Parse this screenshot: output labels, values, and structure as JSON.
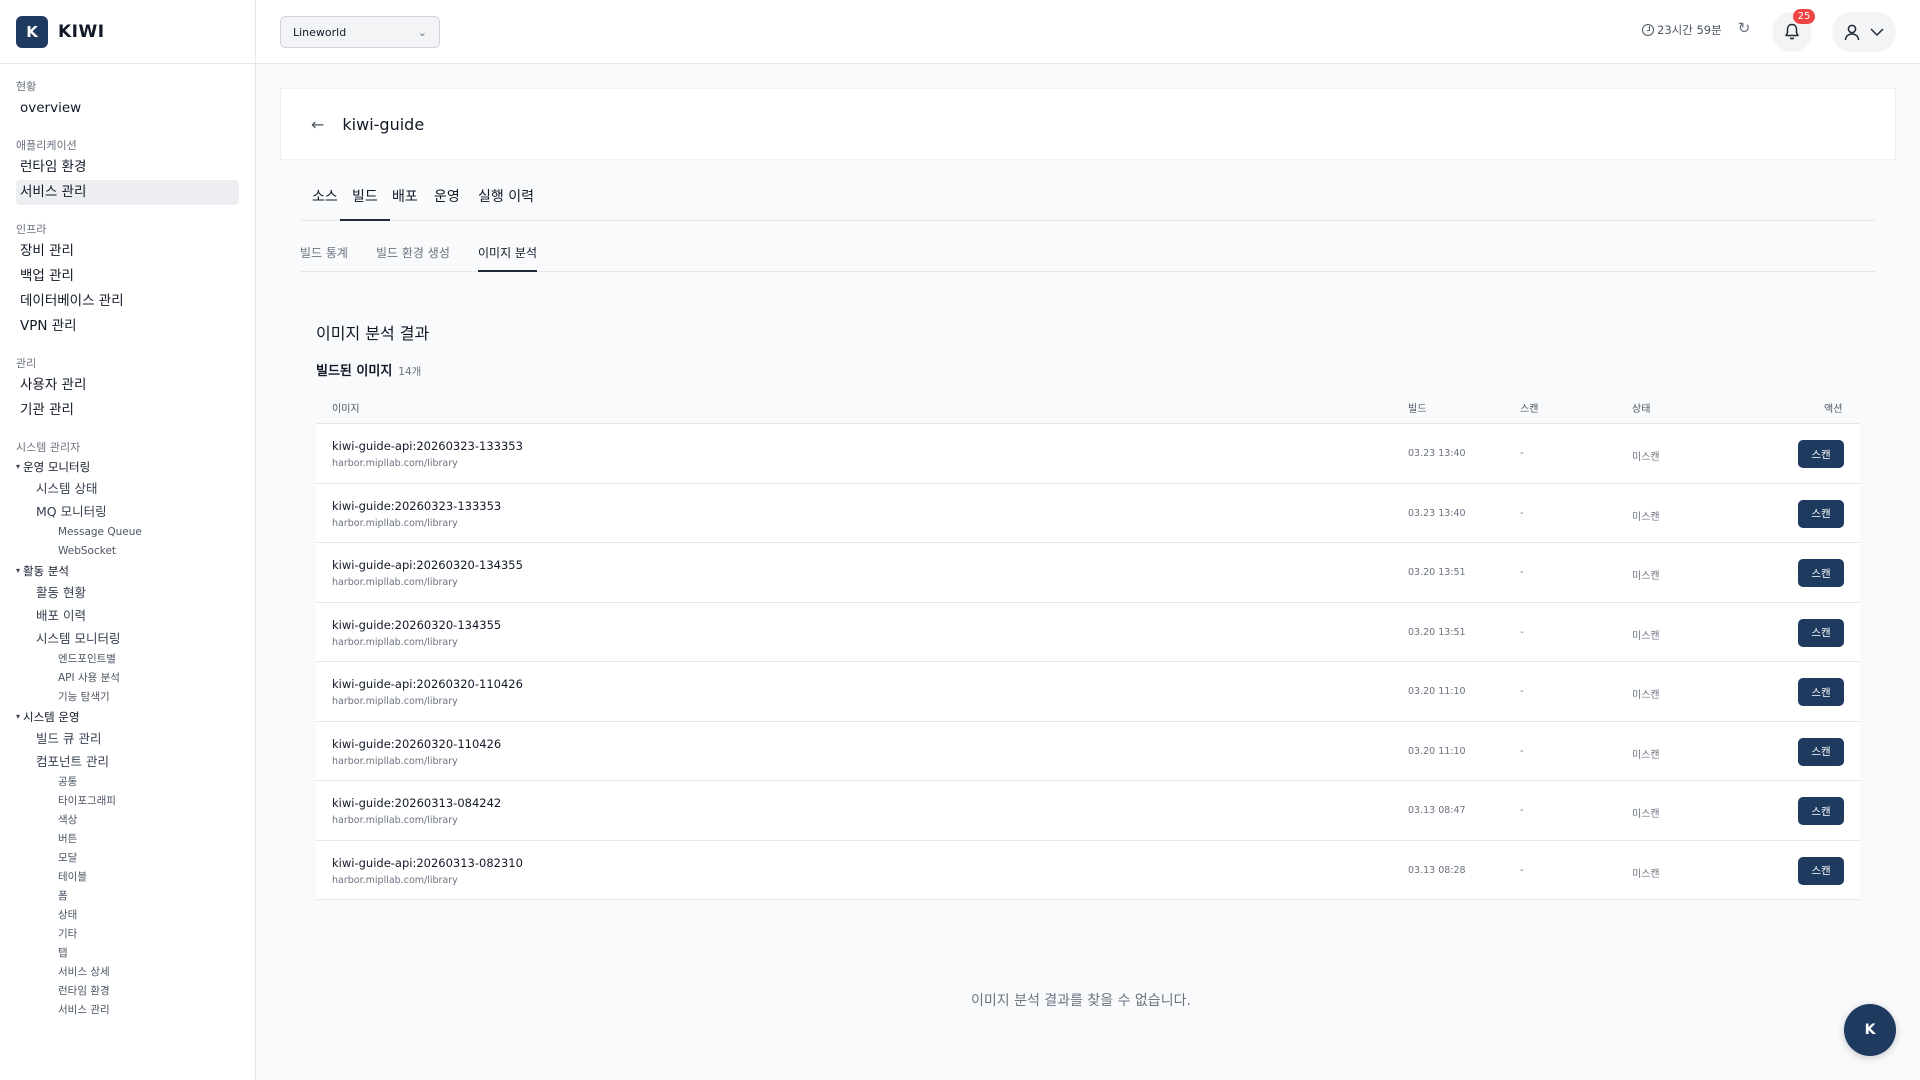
{
  "brand": {
    "logo": "K",
    "name": "KIWI"
  },
  "sidebar": {
    "sections": [
      {
        "label": "현황",
        "items": [
          {
            "label": "overview"
          }
        ]
      },
      {
        "label": "애플리케이션",
        "items": [
          {
            "label": "런타임 환경"
          },
          {
            "label": "서비스 관리",
            "active": true
          }
        ]
      },
      {
        "label": "인프라",
        "items": [
          {
            "label": "장비 관리"
          },
          {
            "label": "백업 관리"
          },
          {
            "label": "데이터베이스 관리"
          },
          {
            "label": "VPN 관리"
          }
        ]
      },
      {
        "label": "관리",
        "items": [
          {
            "label": "사용자 관리"
          },
          {
            "label": "기관 관리"
          }
        ]
      }
    ],
    "admin": {
      "label": "시스템 관리자",
      "groups": [
        {
          "label": "운영 모니터링",
          "children": [
            {
              "label": "시스템 상태"
            },
            {
              "label": "MQ 모니터링",
              "children": [
                "Message Queue",
                "WebSocket"
              ]
            }
          ]
        },
        {
          "label": "활동 분석",
          "children": [
            {
              "label": "활동 현황"
            },
            {
              "label": "배포 이력"
            },
            {
              "label": "시스템 모니터링",
              "children": [
                "엔드포인트별",
                "API 사용 분석",
                "기능 탐색기"
              ]
            }
          ]
        },
        {
          "label": "시스템 운영",
          "children": [
            {
              "label": "빌드 큐 관리"
            },
            {
              "label": "컴포넌트 관리",
              "children": [
                "공통",
                "타이포그래피",
                "색상",
                "버튼",
                "모달",
                "테이블",
                "폼",
                "상태",
                "기타",
                "탭",
                "서비스 상세",
                "런타임 환경",
                "서비스 관리"
              ]
            }
          ]
        }
      ]
    }
  },
  "topbar": {
    "project": "Lineworld",
    "session_time": "23시간 59분",
    "notification_count": "25"
  },
  "page": {
    "title": "kiwi-guide",
    "tabs": [
      "소스",
      "빌드",
      "배포",
      "운영",
      "실행 이력"
    ],
    "active_tab": 1,
    "subtabs": [
      "빌드 통계",
      "빌드 환경 생성",
      "이미지 분석"
    ],
    "active_subtab": 2,
    "section_title": "이미지 분석 결과",
    "list_title": "빌드된 이미지",
    "list_count": "14개",
    "columns": {
      "image": "이미지",
      "build": "빌드",
      "scan": "스캔",
      "status": "상태",
      "action": "액션"
    },
    "scan_label": "스캔",
    "rows": [
      {
        "name": "kiwi-guide-api:20260323-133353",
        "registry": "harbor.mipllab.com/library",
        "build": "03.23 13:40",
        "scan": "-",
        "status": "미스캔"
      },
      {
        "name": "kiwi-guide:20260323-133353",
        "registry": "harbor.mipllab.com/library",
        "build": "03.23 13:40",
        "scan": "-",
        "status": "미스캔"
      },
      {
        "name": "kiwi-guide-api:20260320-134355",
        "registry": "harbor.mipllab.com/library",
        "build": "03.20 13:51",
        "scan": "-",
        "status": "미스캔"
      },
      {
        "name": "kiwi-guide:20260320-134355",
        "registry": "harbor.mipllab.com/library",
        "build": "03.20 13:51",
        "scan": "-",
        "status": "미스캔"
      },
      {
        "name": "kiwi-guide-api:20260320-110426",
        "registry": "harbor.mipllab.com/library",
        "build": "03.20 11:10",
        "scan": "-",
        "status": "미스캔"
      },
      {
        "name": "kiwi-guide:20260320-110426",
        "registry": "harbor.mipllab.com/library",
        "build": "03.20 11:10",
        "scan": "-",
        "status": "미스캔"
      },
      {
        "name": "kiwi-guide:20260313-084242",
        "registry": "harbor.mipllab.com/library",
        "build": "03.13 08:47",
        "scan": "-",
        "status": "미스캔"
      },
      {
        "name": "kiwi-guide-api:20260313-082310",
        "registry": "harbor.mipllab.com/library",
        "build": "03.13 08:28",
        "scan": "-",
        "status": "미스캔"
      }
    ],
    "empty_message": "이미지 분석 결과를 찾을 수 없습니다."
  },
  "fab_label": "K",
  "colors": {
    "accent": "#1e3a5f",
    "badge": "#ef4444"
  }
}
